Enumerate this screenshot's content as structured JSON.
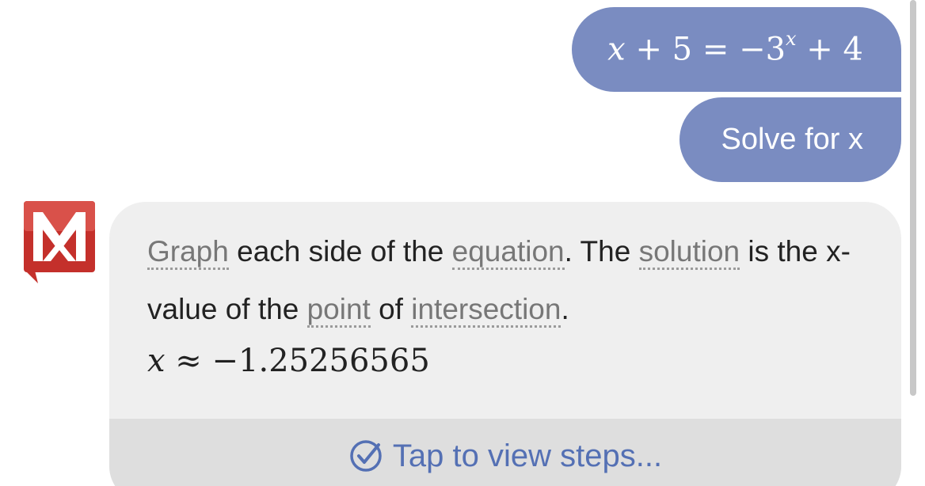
{
  "user_messages": {
    "equation": {
      "lhs_var": "x",
      "lhs_op": " + 5 = −3",
      "exponent": "x",
      "rhs_tail": " + 4"
    },
    "command": "Solve for x"
  },
  "answer": {
    "segments": [
      {
        "text": "Graph",
        "term": true
      },
      {
        "text": " each side of the ",
        "term": false
      },
      {
        "text": "equation",
        "term": true
      },
      {
        "text": ". The ",
        "term": false
      },
      {
        "text": "solution",
        "term": true
      },
      {
        "text": " is the x-value of the ",
        "term": false
      },
      {
        "text": "point",
        "term": true
      },
      {
        "text": " of ",
        "term": false
      },
      {
        "text": "intersection",
        "term": true
      },
      {
        "text": ".",
        "term": false
      }
    ],
    "result": {
      "variable": "x",
      "value": " ≈ −1.25256565"
    },
    "steps_label": "Tap to view steps..."
  },
  "colors": {
    "user_bubble": "#7a8cc1",
    "answer_card": "#efefef",
    "steps_bar": "#dedede",
    "accent": "#5470b4",
    "logo_red": "#c4302b"
  },
  "icons": {
    "logo": "mathway-logo-icon",
    "steps": "check-circle-icon"
  }
}
